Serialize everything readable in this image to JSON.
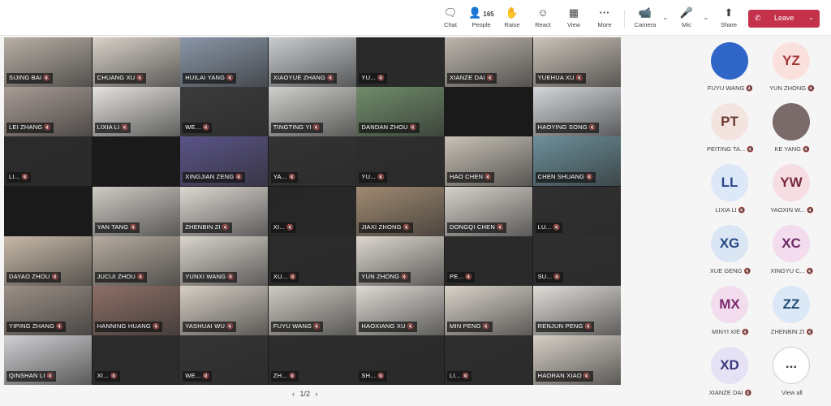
{
  "toolbar": {
    "chat": {
      "icon": "chat-icon",
      "label": "Chat"
    },
    "people": {
      "icon": "people-icon",
      "label": "People",
      "count": "165"
    },
    "raise": {
      "icon": "raise-hand-icon",
      "label": "Raise"
    },
    "react": {
      "icon": "react-icon",
      "label": "React"
    },
    "view": {
      "icon": "grid-view-icon",
      "label": "View"
    },
    "more": {
      "icon": "more-icon",
      "label": "More"
    },
    "camera": {
      "icon": "camera-off-icon",
      "label": "Camera"
    },
    "mic": {
      "icon": "mic-off-icon",
      "label": "Mic"
    },
    "share": {
      "icon": "share-icon",
      "label": "Share"
    },
    "leave": {
      "icon": "phone-icon",
      "label": "Leave"
    }
  },
  "colors": {
    "leave": "#c4314b",
    "accent": "#5b5fc7"
  },
  "tiles": [
    {
      "name": "SIJING BAI"
    },
    {
      "name": "CHUANG XU"
    },
    {
      "name": "HUILAI YANG"
    },
    {
      "name": "XIAOYUE ZHANG"
    },
    {
      "name": "YU..."
    },
    {
      "name": "XIANZE DAI"
    },
    {
      "name": "YUEHUA XU"
    },
    {
      "name": "LEI ZHANG"
    },
    {
      "name": "LIXIA LI"
    },
    {
      "name": "WE..."
    },
    {
      "name": "TINGTING YI"
    },
    {
      "name": "DANDAN ZHOU"
    },
    {
      "name": "HAOYING SONG"
    },
    {
      "name": "LI..."
    },
    {
      "name": "XINGJIAN ZENG"
    },
    {
      "name": "YA..."
    },
    {
      "name": "YU..."
    },
    {
      "name": "HAO CHEN"
    },
    {
      "name": "CHEN SHUANG"
    },
    {
      "name": "YAN TANG"
    },
    {
      "name": "ZHENBIN ZI"
    },
    {
      "name": "XI..."
    },
    {
      "name": "JIAXI ZHONG"
    },
    {
      "name": "DONGQI CHEN"
    },
    {
      "name": "LU..."
    },
    {
      "name": "DAYAO ZHOU"
    },
    {
      "name": "JUCUI ZHOU"
    },
    {
      "name": "YUNXI WANG"
    },
    {
      "name": "XU..."
    },
    {
      "name": "YUN ZHONG"
    },
    {
      "name": "PE..."
    },
    {
      "name": "SU..."
    },
    {
      "name": "YIPING ZHANG"
    },
    {
      "name": "HANNING HUANG"
    },
    {
      "name": "YASHUAI WU"
    },
    {
      "name": "FUYU WANG"
    },
    {
      "name": "HAOXIANG XU"
    },
    {
      "name": "MIN PENG"
    },
    {
      "name": "RENJUN PENG"
    },
    {
      "name": "QINSHAN LI"
    },
    {
      "name": "XI..."
    },
    {
      "name": "WE..."
    },
    {
      "name": "ZH..."
    },
    {
      "name": "SH..."
    },
    {
      "name": "LI..."
    },
    {
      "name": "HAORAN XIAO"
    }
  ],
  "pager": {
    "text": "1/2",
    "prev": "‹",
    "next": "›"
  },
  "sidebar": [
    {
      "initials": "",
      "name": "FUYU WANG",
      "bg": "#2f66c8",
      "fg": "#ffffff",
      "photo": true
    },
    {
      "initials": "YZ",
      "name": "YUN ZHONG",
      "bg": "#fbe1de",
      "fg": "#a4373a"
    },
    {
      "initials": "PT",
      "name": "PEITING TA...",
      "bg": "#f3e4df",
      "fg": "#6b3b32"
    },
    {
      "initials": "",
      "name": "KE YANG",
      "bg": "#7a6a6a",
      "fg": "#ffffff",
      "photo": true
    },
    {
      "initials": "LL",
      "name": "LIXIA LI",
      "bg": "#dce8f7",
      "fg": "#2b4a8a"
    },
    {
      "initials": "YW",
      "name": "YAOXIN W...",
      "bg": "#f6dde3",
      "fg": "#7a2a3c"
    },
    {
      "initials": "XG",
      "name": "XUE GENG",
      "bg": "#dbe6f5",
      "fg": "#274a82"
    },
    {
      "initials": "XC",
      "name": "XINGYU C...",
      "bg": "#f2dced",
      "fg": "#6d2a66"
    },
    {
      "initials": "MX",
      "name": "MINYI XIE",
      "bg": "#f2dced",
      "fg": "#7b2a6e"
    },
    {
      "initials": "ZZ",
      "name": "ZHENBIN ZI",
      "bg": "#dbe8f6",
      "fg": "#1e4a78"
    },
    {
      "initials": "XD",
      "name": "XIANZE DAI",
      "bg": "#e4e2f4",
      "fg": "#3e3a80"
    },
    {
      "initials": "...",
      "name": "View all",
      "bg": "#ffffff",
      "fg": "#424242",
      "view_all": true
    }
  ]
}
